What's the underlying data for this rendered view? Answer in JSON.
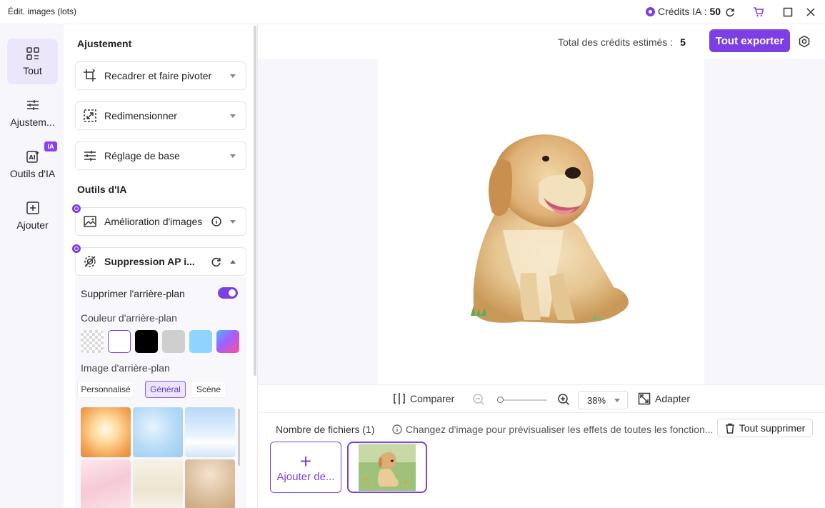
{
  "window": {
    "title": "Édit. images (lots)",
    "credits_label": "Crédits IA :",
    "credits_value": "50"
  },
  "nav": {
    "items": [
      {
        "label": "Tout",
        "icon": "grid-icon"
      },
      {
        "label": "Ajustem...",
        "icon": "sliders-icon"
      },
      {
        "label": "Outils d'IA",
        "icon": "ai-icon"
      },
      {
        "label": "Ajouter",
        "icon": "plus-square-icon"
      }
    ],
    "ia_badge": "IA"
  },
  "panel": {
    "adjust_title": "Ajustement",
    "adjust_items": [
      {
        "label": "Recadrer et faire pivoter",
        "icon": "crop-rotate-icon"
      },
      {
        "label": "Redimensionner",
        "icon": "resize-icon"
      },
      {
        "label": "Réglage de base",
        "icon": "sliders-icon"
      }
    ],
    "ai_title": "Outils d'IA",
    "ai_items": [
      {
        "label": "Amélioration d'images",
        "icon": "enhance-icon"
      },
      {
        "label": "Suppression AP i...",
        "icon": "bg-remove-icon"
      }
    ],
    "bg_toggle_label": "Supprimer l'arrière-plan",
    "bg_color_label": "Couleur d'arrière-plan",
    "bg_colors": [
      "transparent",
      "#ffffff",
      "#000000",
      "#cfcfcf",
      "#8fd3ff",
      "gradient"
    ],
    "bg_image_label": "Image d'arrière-plan",
    "bg_tabs": [
      "Personnalisé",
      "Général",
      "Scène"
    ],
    "bg_tab_active": "Général"
  },
  "main": {
    "total_label": "Total des crédits estimés :",
    "total_value": "5",
    "export_label": "Tout exporter",
    "compare_label": "Comparer",
    "zoom_value": "38%",
    "fit_label": "Adapter",
    "files_count": "Nombre de fichiers (1)",
    "files_hint": "Changez d'image pour prévisualiser les effets de toutes les fonction...",
    "delete_all": "Tout supprimer",
    "add_file": "Ajouter de..."
  },
  "colors": {
    "accent": "#7b3fe4",
    "nav_active": "#ece6fb",
    "canvas_bg": "#f7f6fb"
  }
}
